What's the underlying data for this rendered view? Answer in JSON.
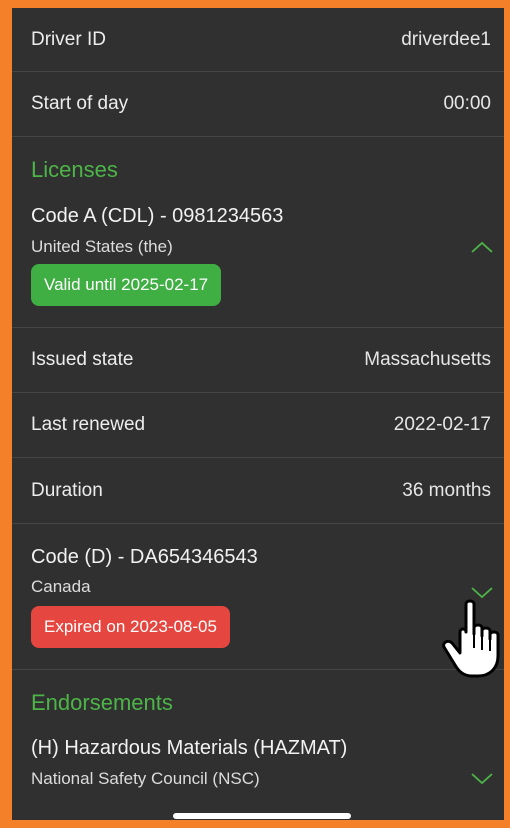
{
  "driver": {
    "id_label": "Driver ID",
    "id_value": "driverdee1"
  },
  "start_of_day": {
    "label": "Start of day",
    "value": "00:00"
  },
  "licenses": {
    "section_title": "Licenses",
    "items": [
      {
        "title": "Code A (CDL) - 0981234563",
        "country": "United States (the)",
        "status": "Valid until 2025-02-17",
        "status_color": "#3fae43",
        "expanded": true,
        "details": [
          {
            "label": "Issued state",
            "value": "Massachusetts"
          },
          {
            "label": "Last renewed",
            "value": "2022-02-17"
          },
          {
            "label": "Duration",
            "value": "36 months"
          }
        ]
      },
      {
        "title": "Code (D) - DA654346543",
        "country": "Canada",
        "status": "Expired on 2023-08-05",
        "status_color": "#e5463f",
        "expanded": false
      }
    ]
  },
  "endorsements": {
    "section_title": "Endorsements",
    "items": [
      {
        "title": "(H) Hazardous Materials (HAZMAT)",
        "issuer": "National Safety Council (NSC)",
        "expanded": false
      }
    ]
  },
  "colors": {
    "accent_green": "#4db548",
    "background": "#303030",
    "frame": "#f4802a"
  },
  "icons": {
    "chevron_up": "chevron-up-icon",
    "chevron_down": "chevron-down-icon",
    "cursor": "hand-pointer-icon"
  }
}
